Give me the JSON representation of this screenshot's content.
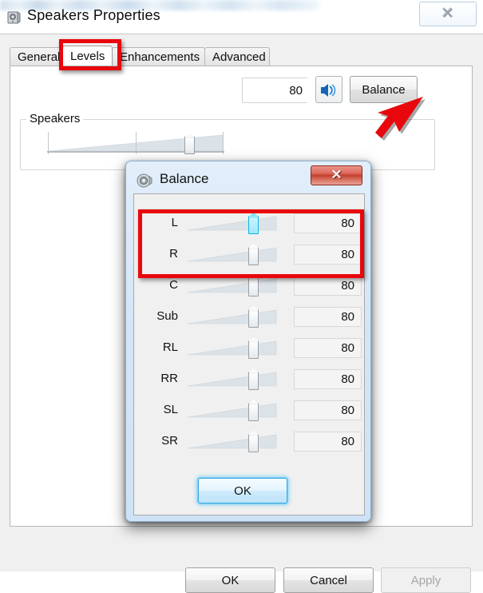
{
  "window": {
    "title": "Speakers Properties",
    "icon": "speaker-icon",
    "close_glyph": "✕"
  },
  "tabs": [
    {
      "label": "General",
      "active": false
    },
    {
      "label": "Levels",
      "active": true
    },
    {
      "label": "Enhancements",
      "active": false
    },
    {
      "label": "Advanced",
      "active": false
    }
  ],
  "speakers_group": {
    "legend": "Speakers",
    "volume_value": "80",
    "mute_icon": "volume-speaker-icon",
    "balance_button": "Balance"
  },
  "annotations": {
    "levels_box_color": "#e8070c",
    "arrow_color": "#e8070c",
    "lr_box_color": "#e8070c"
  },
  "footer": {
    "ok": "OK",
    "cancel": "Cancel",
    "apply": "Apply"
  },
  "balance_dialog": {
    "title": "Balance",
    "icon": "speaker-icon",
    "close_glyph": "✕",
    "ok": "OK",
    "channels": [
      {
        "label": "L",
        "value": "80",
        "highlighted": true
      },
      {
        "label": "R",
        "value": "80",
        "highlighted": false
      },
      {
        "label": "C",
        "value": "80",
        "highlighted": false
      },
      {
        "label": "Sub",
        "value": "80",
        "highlighted": false
      },
      {
        "label": "RL",
        "value": "80",
        "highlighted": false
      },
      {
        "label": "RR",
        "value": "80",
        "highlighted": false
      },
      {
        "label": "SL",
        "value": "80",
        "highlighted": false
      },
      {
        "label": "SR",
        "value": "80",
        "highlighted": false
      }
    ]
  }
}
